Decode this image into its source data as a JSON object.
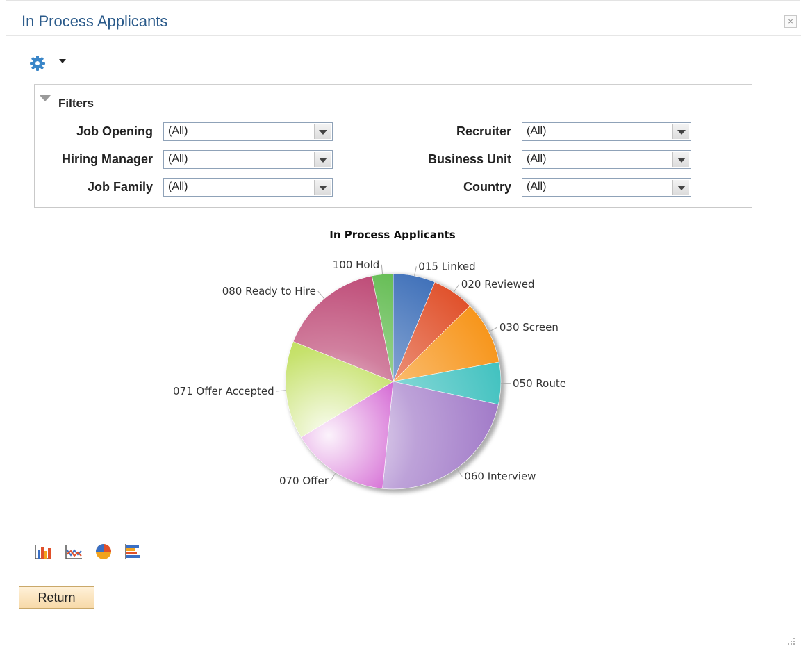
{
  "window": {
    "title": "In Process Applicants",
    "close_icon": "close-icon"
  },
  "toolbar": {
    "gear_icon": "gear-icon",
    "menu_icon": "caret-down-icon"
  },
  "filters": {
    "heading": "Filters",
    "fields": [
      {
        "label": "Job Opening",
        "value": "(All)"
      },
      {
        "label": "Hiring Manager",
        "value": "(All)"
      },
      {
        "label": "Job Family",
        "value": "(All)"
      },
      {
        "label": "Recruiter",
        "value": "(All)"
      },
      {
        "label": "Business Unit",
        "value": "(All)"
      },
      {
        "label": "Country",
        "value": "(All)"
      }
    ]
  },
  "chart_data": {
    "type": "pie",
    "title": "In Process Applicants",
    "slices": [
      {
        "label": "015 Linked",
        "value": 6,
        "color": "#3c6eb8"
      },
      {
        "label": "020 Reviewed",
        "value": 6,
        "color": "#e0502a"
      },
      {
        "label": "030 Screen",
        "value": 9,
        "color": "#f7951a"
      },
      {
        "label": "050 Route",
        "value": 6,
        "color": "#3cc0be"
      },
      {
        "label": "060 Interview",
        "value": 22,
        "color": "#9a70c4"
      },
      {
        "label": "070 Offer",
        "value": 14,
        "color": "#bb0fba"
      },
      {
        "label": "071 Offer Accepted",
        "value": 14,
        "color": "#a8d21e"
      },
      {
        "label": "080 Ready to Hire",
        "value": 15,
        "color": "#b83a6a"
      },
      {
        "label": "100 Hold",
        "value": 3,
        "color": "#5cb94a"
      }
    ]
  },
  "chart_types": [
    {
      "name": "bar-chart-icon"
    },
    {
      "name": "line-chart-icon"
    },
    {
      "name": "pie-chart-icon"
    },
    {
      "name": "horizontal-bar-chart-icon"
    }
  ],
  "actions": {
    "return_label": "Return"
  }
}
